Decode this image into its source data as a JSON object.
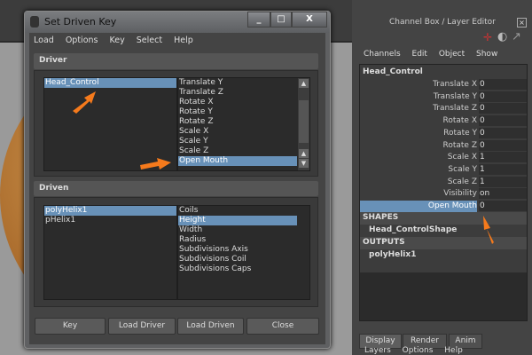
{
  "dialog": {
    "title": "Set Driven Key",
    "window_buttons": [
      "_",
      "□",
      "X"
    ],
    "menu": [
      "Load",
      "Options",
      "Key",
      "Select",
      "Help"
    ],
    "driver": {
      "header": "Driver",
      "objects": [
        "Head_Control"
      ],
      "selected_object": 0,
      "attributes": [
        "Translate Y",
        "Translate Z",
        "Rotate X",
        "Rotate Y",
        "Rotate Z",
        "Scale X",
        "Scale Y",
        "Scale Z",
        "Open Mouth"
      ],
      "selected_attribute": 8
    },
    "driven": {
      "header": "Driven",
      "objects": [
        "polyHelix1",
        "pHelix1"
      ],
      "selected_object": 0,
      "attributes": [
        "Coils",
        "Height",
        "Width",
        "Radius",
        "Subdivisions Axis",
        "Subdivisions Coil",
        "Subdivisions Caps"
      ],
      "selected_attribute": 1
    },
    "buttons": {
      "key": "Key",
      "load_driver": "Load Driver",
      "load_driven": "Load Driven",
      "close": "Close"
    }
  },
  "channel_box": {
    "title": "Channel Box / Layer Editor",
    "menu": [
      "Channels",
      "Edit",
      "Object",
      "Show"
    ],
    "object": "Head_Control",
    "channels": [
      [
        "Translate X",
        "0"
      ],
      [
        "Translate Y",
        "0"
      ],
      [
        "Translate Z",
        "0"
      ],
      [
        "Rotate X",
        "0"
      ],
      [
        "Rotate Y",
        "0"
      ],
      [
        "Rotate Z",
        "0"
      ],
      [
        "Scale X",
        "1"
      ],
      [
        "Scale Y",
        "1"
      ],
      [
        "Scale Z",
        "1"
      ],
      [
        "Visibility",
        "on"
      ],
      [
        "Open Mouth",
        "0"
      ]
    ],
    "selected_channel": 10,
    "shapes_label": "SHAPES",
    "shape": "Head_ControlShape",
    "outputs_label": "OUTPUTS",
    "output": "polyHelix1",
    "tabs": [
      "Display",
      "Render",
      "Anim"
    ],
    "active_tab": 0,
    "layer_menu": [
      "Layers",
      "Options",
      "Help"
    ]
  },
  "colors": {
    "selection": "#6891b8",
    "annotation_arrow": "#f57a1c"
  }
}
